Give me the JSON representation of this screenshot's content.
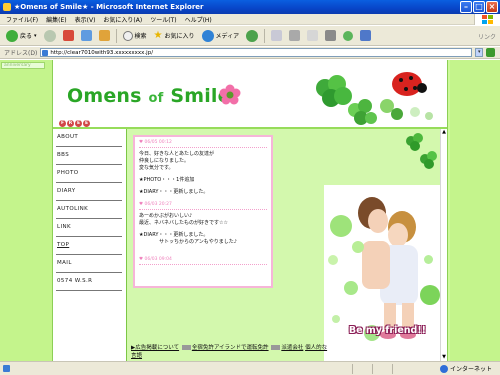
{
  "window": {
    "title": "★Omens of Smile★ - Microsoft Internet Explorer"
  },
  "menu": [
    "ファイル(F)",
    "編集(E)",
    "表示(V)",
    "お気に入り(A)",
    "ツール(T)",
    "ヘルプ(H)"
  ],
  "toolbar": {
    "back": "戻る",
    "search": "検索",
    "favorites": "お気に入り",
    "media": "メディア",
    "links": "リンク"
  },
  "address": {
    "label": "アドレス(D)",
    "url": "http://clear7010with93.xxxxxxxxx.jp/"
  },
  "page_tab": "anniversary",
  "site": {
    "logo_main": "Omens",
    "logo_of": "of",
    "logo_end": "Smile",
    "dots": [
      "F",
      "R",
      "E",
      "E"
    ],
    "nav": [
      "ABOUT",
      "BBS",
      "PHOTO",
      "DIARY",
      "AUTOLINK",
      "LINK",
      "TOP",
      "MAIL",
      "0574 W.S.R"
    ],
    "blog": [
      {
        "date": "06/05 00:12",
        "lines": [
          "今日、好きな人とあたしの友達が",
          "仲良しになりました。",
          "変な気分です。",
          "",
          "★PHOTO・・・1件追加",
          "",
          "★DIARY・・・更新しました。"
        ]
      },
      {
        "date": "06/03 20:27",
        "lines": [
          "あーめかぶがおいしい♪",
          "最近、ネバネバしたものが好きです☆☆",
          "",
          "★DIARY・・・更新しました。",
          "　　　　サトッちからのアンもやりました♪"
        ]
      },
      {
        "date": "06/03 09:04",
        "lines": []
      }
    ],
    "friend": "Be my friend!!",
    "ticker": [
      "▶広告掲載について",
      "全宿免許アイランドで運転免許",
      "派遣会社",
      "個人的な",
      "言語"
    ]
  },
  "status": {
    "zone": "インターネット"
  },
  "colors": {
    "accent": "#2aa626",
    "page_bg": "#cdfa9a",
    "content_bg": "#d3f8ad",
    "blog_border": "#f6b5d8"
  }
}
